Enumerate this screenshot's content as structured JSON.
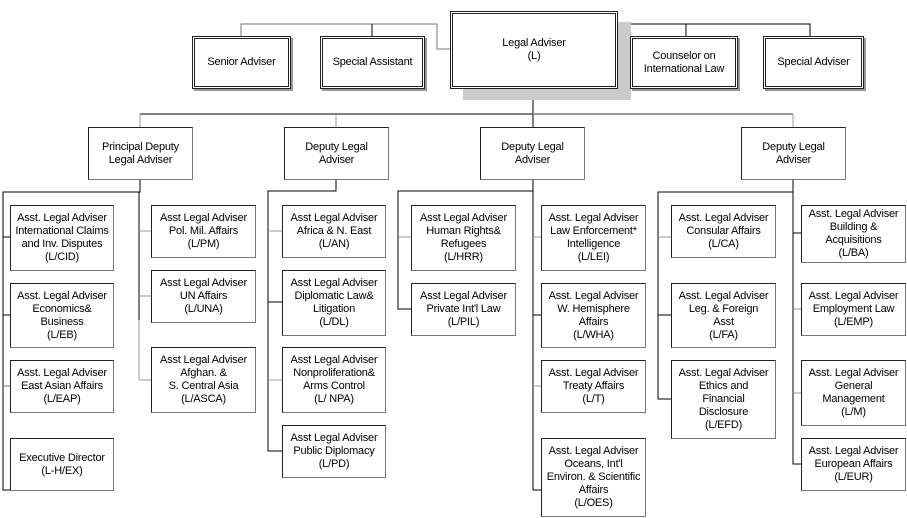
{
  "top": {
    "legal_adviser": "Legal Adviser\n(L)",
    "senior_adviser": "Senior Adviser",
    "special_assistant": "Special Assistant",
    "counselor": "Counselor on\nInternational Law",
    "special_adviser": "Special Adviser"
  },
  "deputies": [
    "Principal Deputy\nLegal Adviser",
    "Deputy Legal\nAdviser",
    "Deputy Legal\nAdviser",
    "Deputy Legal\nAdviser"
  ],
  "offices": {
    "cid": "Asst. Legal Adviser\nInternational Claims\nand Inv. Disputes\n(L/CID)",
    "eb": "Asst. Legal Adviser\nEconomics&\nBusiness\n(L/EB)",
    "eap": "Asst. Legal Adviser\nEast Asian Affairs\n(L/EAP)",
    "ex": "Executive Director\n(L-H/EX)",
    "pm": "Asst Legal Adviser\nPol. Mil. Affairs\n(L/PM)",
    "una": "Asst Legal Adviser\nUN Affairs\n(L/UNA)",
    "asca": "Asst Legal Adviser\nAfghan. &\nS. Central Asia\n(L/ASCA)",
    "an": "Asst Legal Adviser\nAfrica & N. East\n(L/AN)",
    "dl": "Asst Legal Adviser\nDiplomatic Law&\nLitigation\n(L/DL)",
    "npa": "Asst Legal Adviser\nNonproliferation&\nArms Control\n(L/ NPA)",
    "pd": "Asst Legal Adviser\nPublic Diplomacy\n(L/PD)",
    "hrr": "Asst Legal Adviser\nHuman Rights&\nRefugees\n(L/HRR)",
    "pil": "Asst Legal Adviser\nPrivate Int'l Law\n(L/PIL)",
    "lei": "Asst. Legal Adviser\nLaw Enforcement*\nIntelligence\n(L/LEI)",
    "wha": "Asst. Legal Adviser\nW. Hemisphere\nAffairs\n(L/WHA)",
    "t": "Asst. Legal Adviser\nTreaty Affairs\n(L/T)",
    "oes": "Asst. Legal Adviser\nOceans, Int'l\nEnviron. & Scientific\nAffairs\n(L/OES)",
    "ca": "Asst. Legal Adviser\nConsular Affairs\n(L/CA)",
    "fa": "Asst. Legal Adviser\nLeg. & Foreign\nAsst\n(L/FA)",
    "efd": "Asst. Legal Adviser\nEthics and\nFinancial\nDisclosure\n(L/EFD)",
    "ba": "Asst. Legal Adviser\nBuilding &\nAcquisitions\n(L/BA)",
    "emp": "Asst. Legal Adviser\nEmployment Law\n(L/EMP)",
    "m": "Asst. Legal Adviser\nGeneral\nManagement\n(L/M)",
    "eur": "Asst. Legal Adviser\nEuropean Affairs\n(L/EUR)"
  }
}
